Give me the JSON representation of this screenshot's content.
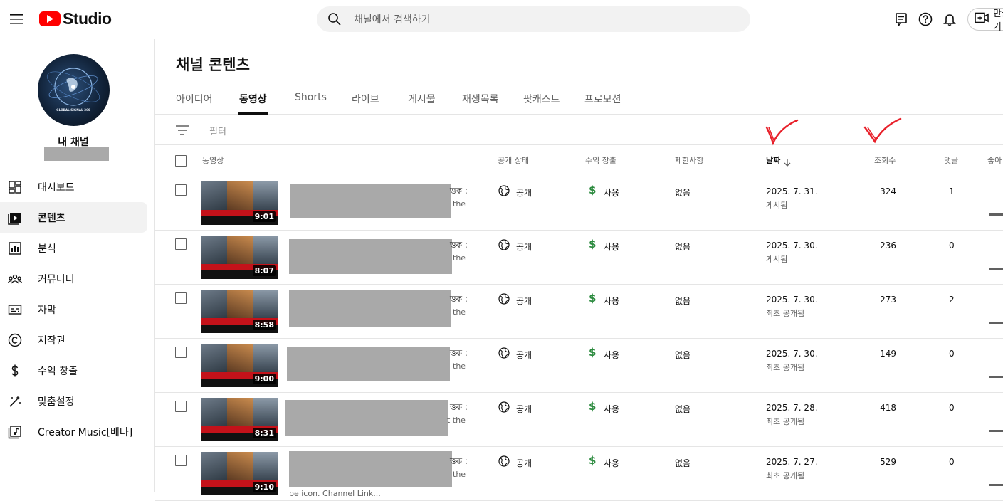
{
  "app": {
    "brand": "Studio",
    "search_placeholder": "채널에서 검색하기",
    "create_label": "만들기",
    "brand_color": "#ff0000"
  },
  "sidebar": {
    "channel_title": "내 채널",
    "avatar_text": "GLOBAL SIGNAL 360",
    "items": [
      {
        "label": "대시보드",
        "icon": "dashboard-icon",
        "active": false
      },
      {
        "label": "콘텐츠",
        "icon": "content-icon",
        "active": true
      },
      {
        "label": "분석",
        "icon": "analytics-icon",
        "active": false
      },
      {
        "label": "커뮤니티",
        "icon": "community-icon",
        "active": false
      },
      {
        "label": "자막",
        "icon": "subtitles-icon",
        "active": false
      },
      {
        "label": "저작권",
        "icon": "copyright-icon",
        "active": false
      },
      {
        "label": "수익 창출",
        "icon": "dollar-icon",
        "active": false
      },
      {
        "label": "맞춤설정",
        "icon": "magic-wand-icon",
        "active": false
      },
      {
        "label": "Creator Music[베타]",
        "icon": "music-library-icon",
        "active": false
      }
    ]
  },
  "main": {
    "title": "채널 콘텐츠",
    "tabs": [
      "아이디어",
      "동영상",
      "Shorts",
      "라이브",
      "게시물",
      "재생목록",
      "팟캐스트",
      "프로모션"
    ],
    "active_tab": "동영상",
    "filter_label": "필터",
    "columns": {
      "video": "동영상",
      "visibility": "공개 상태",
      "monetization": "수익 창출",
      "restrictions": "제한사항",
      "date": "날짜",
      "views": "조회수",
      "comments": "댓글",
      "likes": "좋아"
    },
    "rows": [
      {
        "duration": "9:01",
        "title_frag": "ত্তক :",
        "desc_frag": "the",
        "visibility": "공개",
        "monetization": "사용",
        "restriction": "없음",
        "date": "2025. 7. 31.",
        "date_status": "게시됨",
        "views": "324",
        "comments": "1"
      },
      {
        "duration": "8:07",
        "title_frag": "ত্তক :",
        "desc_frag": "the",
        "visibility": "공개",
        "monetization": "사용",
        "restriction": "없음",
        "date": "2025. 7. 30.",
        "date_status": "게시됨",
        "views": "236",
        "comments": "0"
      },
      {
        "duration": "8:58",
        "title_frag": "ত্তক :",
        "desc_frag": "the",
        "visibility": "공개",
        "monetization": "사용",
        "restriction": "없음",
        "date": "2025. 7. 30.",
        "date_status": "최초 공개됨",
        "views": "273",
        "comments": "2"
      },
      {
        "duration": "9:00",
        "title_frag": "ত্তক :",
        "desc_frag": "the",
        "visibility": "공개",
        "monetization": "사용",
        "restriction": "없음",
        "date": "2025. 7. 30.",
        "date_status": "최초 공개됨",
        "views": "149",
        "comments": "0"
      },
      {
        "duration": "8:31",
        "title_frag": "ত্তক :",
        "desc_frag": "t the",
        "visibility": "공개",
        "monetization": "사용",
        "restriction": "없음",
        "date": "2025. 7. 28.",
        "date_status": "최초 공개됨",
        "views": "418",
        "comments": "0"
      },
      {
        "duration": "9:10",
        "title_frag": "ত্তক :",
        "desc_frag": "the",
        "desc_frag2": "be icon. Channel Link...",
        "visibility": "공개",
        "monetization": "사용",
        "restriction": "없음",
        "date": "2025. 7. 27.",
        "date_status": "최초 공개됨",
        "views": "529",
        "comments": "0"
      }
    ]
  }
}
